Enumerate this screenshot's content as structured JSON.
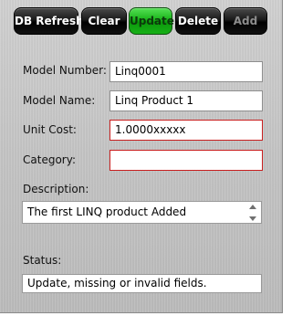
{
  "toolbar": {
    "db_refresh": "DB Refresh",
    "clear": "Clear",
    "update": "Update",
    "delete": "Delete",
    "add": "Add"
  },
  "form": {
    "model_number_label": "Model Number:",
    "model_number_value": "Linq0001",
    "model_name_label": "Model Name:",
    "model_name_value": "Linq Product 1",
    "unit_cost_label": "Unit Cost:",
    "unit_cost_value": "1.0000xxxxx",
    "category_label": "Category:",
    "category_value": "",
    "description_label": "Description:",
    "description_value": "The first LINQ product Added",
    "status_label": "Status:",
    "status_value": "Update, missing or invalid fields."
  },
  "colors": {
    "active_button": "#1ab51a",
    "invalid_border": "#c81f1f"
  },
  "icons": {
    "spinner": [
      "spin-up-icon",
      "spin-down-icon"
    ]
  }
}
